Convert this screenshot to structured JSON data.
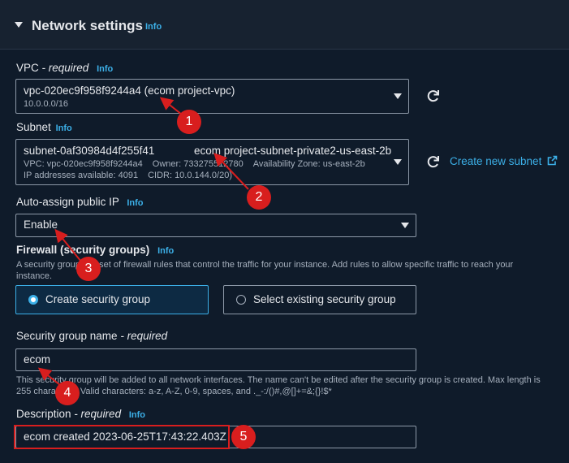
{
  "section": {
    "title": "Network settings",
    "info": "Info"
  },
  "vpc": {
    "label": "VPC",
    "required": "- required",
    "info": "Info",
    "value": "vpc-020ec9f958f9244a4 (ecom project-vpc)",
    "cidr": "10.0.0.0/16"
  },
  "subnet": {
    "label": "Subnet",
    "info": "Info",
    "id": "subnet-0af30984d4f255f41",
    "name": "ecom project-subnet-private2-us-east-2b",
    "vpc": "VPC: vpc-020ec9f958f9244a4",
    "owner": "Owner: 733275512780",
    "az": "Availability Zone: us-east-2b",
    "ips": "IP addresses available: 4091",
    "cidr": "CIDR: 10.0.144.0/20)",
    "create_link": "Create new subnet"
  },
  "auto_assign": {
    "label": "Auto-assign public IP",
    "info": "Info",
    "value": "Enable"
  },
  "firewall": {
    "label": "Firewall (security groups)",
    "info": "Info",
    "help_line1": "A security group is a set of firewall rules that control the traffic for your instance. Add rules to allow specific traffic to reach your",
    "help_line2": "instance.",
    "option_create": "Create security group",
    "option_select": "Select existing security group",
    "selected": "Create security group"
  },
  "sg_name": {
    "label": "Security group name",
    "required": "- required",
    "value": "ecom",
    "help_line1": "This security group will be added to all network interfaces. The name can't be edited after the security group is created. Max length is",
    "help_line2": "255 characters. Valid characters: a-z, A-Z, 0-9, spaces, and ._-:/()#,@[]+=&;{}!$*"
  },
  "description": {
    "label": "Description",
    "required": "- required",
    "info": "Info",
    "value": "ecom created 2023-06-25T17:43:22.403Z"
  },
  "annotations": [
    "1",
    "2",
    "3",
    "4",
    "5"
  ],
  "colors": {
    "background": "#0f1b2a",
    "link": "#3cb0e8",
    "selected_border": "#3cb0e8",
    "annotation": "#d81e1e"
  }
}
